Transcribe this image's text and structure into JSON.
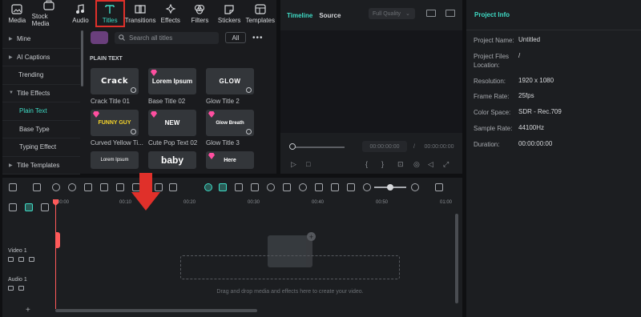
{
  "tabs": [
    {
      "label": "Media",
      "icon": "media-icon"
    },
    {
      "label": "Stock Media",
      "icon": "stock-media-icon"
    },
    {
      "label": "Audio",
      "icon": "audio-icon"
    },
    {
      "label": "Titles",
      "icon": "titles-icon"
    },
    {
      "label": "Transitions",
      "icon": "transitions-icon"
    },
    {
      "label": "Effects",
      "icon": "effects-icon"
    },
    {
      "label": "Filters",
      "icon": "filters-icon"
    },
    {
      "label": "Stickers",
      "icon": "stickers-icon"
    },
    {
      "label": "Templates",
      "icon": "templates-icon"
    }
  ],
  "sidebar": {
    "items": [
      {
        "label": "Mine"
      },
      {
        "label": "AI Captions"
      },
      {
        "label": "Trending"
      },
      {
        "label": "Title Effects"
      },
      {
        "label": "Plain Text"
      },
      {
        "label": "Base Type"
      },
      {
        "label": "Typing Effect"
      },
      {
        "label": "Title Templates"
      }
    ]
  },
  "search": {
    "placeholder": "Search all titles",
    "filter_label": "All"
  },
  "section_title": "PLAIN TEXT",
  "cards": [
    {
      "label": "Crack Title 01",
      "thumb_text": "Crack"
    },
    {
      "label": "Base Title 02",
      "thumb_text": "Lorem Ipsum"
    },
    {
      "label": "Glow Title 2",
      "thumb_text": "GLOW"
    },
    {
      "label": "Curved Yellow Ti...",
      "thumb_text": "FUNNY GUY"
    },
    {
      "label": "Cute Pop Text 02",
      "thumb_text": "NEW"
    },
    {
      "label": "Glow Title 3",
      "thumb_text": "Glow Breath"
    },
    {
      "label": "",
      "thumb_text": "Lorem Ipsum"
    },
    {
      "label": "",
      "thumb_text": "baby"
    },
    {
      "label": "",
      "thumb_text": "Here"
    }
  ],
  "preview": {
    "tab_timeline": "Timeline",
    "tab_source": "Source",
    "quality": "Full Quality",
    "current_time": "00:00:00:00",
    "separator": "/",
    "total_time": "00:00:00:00"
  },
  "info": {
    "title": "Project Info",
    "rows": [
      {
        "key": "Project Name:",
        "value": "Untitled"
      },
      {
        "key": "Project Files Location:",
        "value": "/"
      },
      {
        "key": "Resolution:",
        "value": "1920 x 1080"
      },
      {
        "key": "Frame Rate:",
        "value": "25fps"
      },
      {
        "key": "Color Space:",
        "value": "SDR - Rec.709"
      },
      {
        "key": "Sample Rate:",
        "value": "44100Hz"
      },
      {
        "key": "Duration:",
        "value": "00:00:00:00"
      }
    ]
  },
  "timeline": {
    "ruler": [
      "00:00",
      "00:10",
      "00:20",
      "00:30",
      "00:40",
      "00:50",
      "01:00"
    ],
    "tracks": [
      {
        "name": "Video 1"
      },
      {
        "name": "Audio 1"
      }
    ],
    "drop_text": "Drag and drop media and effects here to create your video."
  },
  "colors": {
    "accent": "#3fdcc6",
    "highlight": "#e0302a",
    "playhead": "#ff5a5a"
  }
}
